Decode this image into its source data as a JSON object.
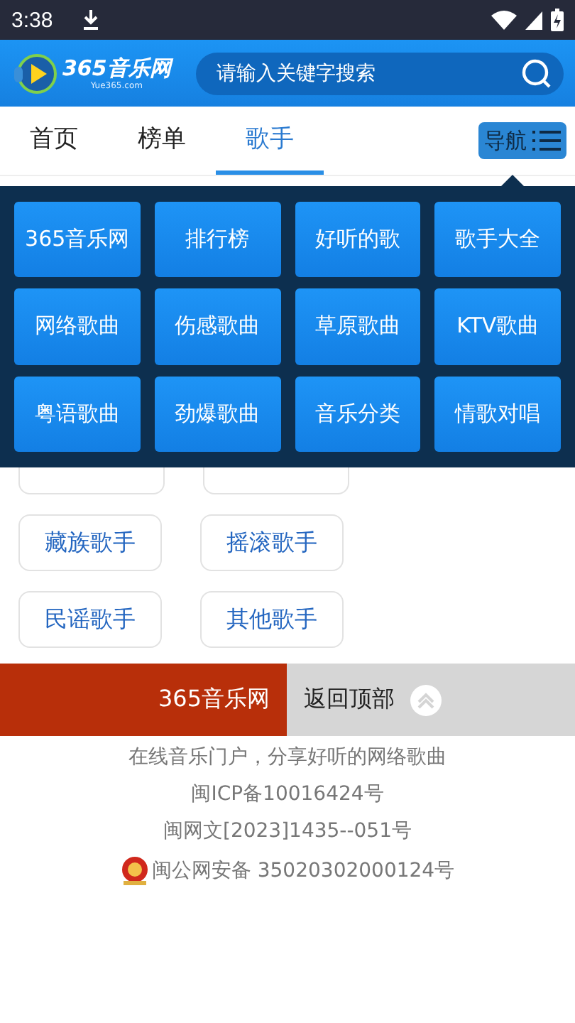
{
  "status_bar": {
    "time": "3:38"
  },
  "header": {
    "logo_text": "365音乐网",
    "logo_sub": "Yue365.com",
    "search": {
      "placeholder": "请输入关键字搜索"
    }
  },
  "tabs": [
    {
      "label": "首页",
      "selected": false
    },
    {
      "label": "榜单",
      "selected": false
    },
    {
      "label": "歌手",
      "selected": true
    }
  ],
  "nav_button": {
    "label": "导航",
    "expanded": true
  },
  "nav_menu": [
    "365音乐网",
    "排行榜",
    "好听的歌",
    "歌手大全",
    "网络歌曲",
    "伤感歌曲",
    "草原歌曲",
    "KTV歌曲",
    "粤语歌曲",
    "劲爆歌曲",
    "音乐分类",
    "情歌对唱"
  ],
  "singer_rows": [
    [
      "藏族歌手",
      "摇滚歌手"
    ],
    [
      "民谣歌手",
      "其他歌手"
    ]
  ],
  "footer_bar": {
    "site": "365音乐网",
    "back_to_top": "返回顶部"
  },
  "footer_lines": [
    "在线音乐门户，分享好听的网络歌曲",
    "闽ICP备10016424号",
    "闽网文[2023]1435--051号"
  ],
  "police_record": "闽公网安备 35020302000124号"
}
